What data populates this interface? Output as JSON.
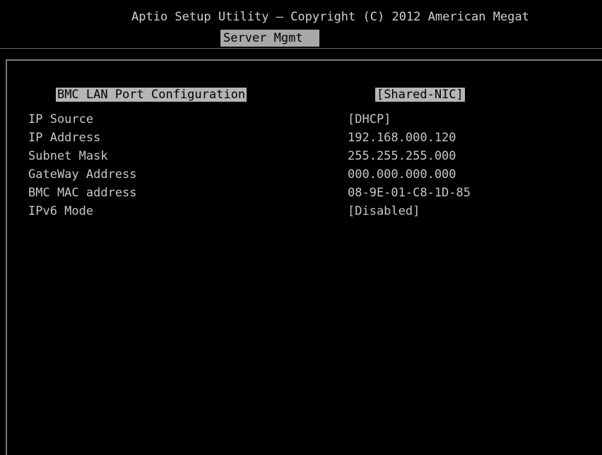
{
  "header": {
    "title": "Aptio Setup Utility – Copyright (C) 2012 American Megat",
    "active_tab": "Server Mgmt"
  },
  "settings": {
    "port_config": {
      "label": "BMC LAN Port Configuration",
      "value": "[Shared-NIC]"
    },
    "items": [
      {
        "label": "IP Source",
        "value": "[DHCP]"
      },
      {
        "label": "IP Address",
        "value": "192.168.000.120"
      },
      {
        "label": "Subnet Mask",
        "value": "255.255.255.000"
      },
      {
        "label": "GateWay Address",
        "value": "000.000.000.000"
      },
      {
        "label": "BMC MAC address",
        "value": "08-9E-01-C8-1D-85"
      },
      {
        "label": "IPv6 Mode",
        "value": "[Disabled]"
      }
    ]
  }
}
